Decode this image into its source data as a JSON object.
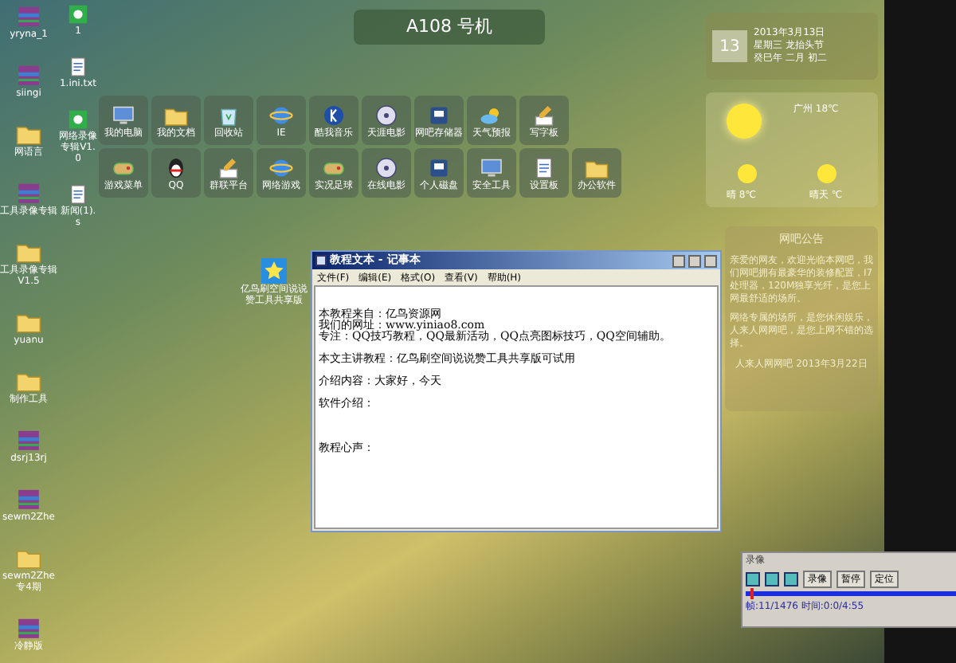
{
  "desktop_icons": [
    {
      "label": "yryna_1",
      "kind": "archive"
    },
    {
      "label": "siingi",
      "kind": "archive"
    },
    {
      "label": "网语言",
      "kind": "folder"
    },
    {
      "label": "工具录像专辑",
      "kind": "archive"
    },
    {
      "label": "工具录像专辑V1.5",
      "kind": "folder"
    },
    {
      "label": "yuanu",
      "kind": "folder"
    },
    {
      "label": "制作工具",
      "kind": "folder"
    },
    {
      "label": "dsrj13rj",
      "kind": "archive"
    },
    {
      "label": "sewm2Zhe",
      "kind": "archive"
    },
    {
      "label": "sewm2Zhe专4期",
      "kind": "folder"
    },
    {
      "label": "冷静版",
      "kind": "archive"
    }
  ],
  "desktop_icons_second_column": [
    {
      "label": "1",
      "kind": "app"
    },
    {
      "label": "1.ini.txt",
      "kind": "file"
    },
    {
      "label": "网络录像专辑V1.0",
      "kind": "app"
    },
    {
      "label": "新闻(1).s",
      "kind": "file"
    }
  ],
  "star_icon": {
    "label": "亿鸟刷空间说说赞工具共享版"
  },
  "machine": {
    "title": "A108 号机"
  },
  "launcher": [
    [
      {
        "label": "我的电脑",
        "kind": "computer"
      },
      {
        "label": "我的文档",
        "kind": "folder"
      },
      {
        "label": "回收站",
        "kind": "bin"
      },
      {
        "label": "IE",
        "kind": "ie"
      },
      {
        "label": "酷我音乐",
        "kind": "music"
      },
      {
        "label": "天涯电影",
        "kind": "film"
      },
      {
        "label": "网吧存储器",
        "kind": "disk"
      },
      {
        "label": "天气预报",
        "kind": "weather"
      },
      {
        "label": "写字板",
        "kind": "pencil"
      }
    ],
    [
      {
        "label": "游戏菜单",
        "kind": "game"
      },
      {
        "label": "QQ",
        "kind": "qq"
      },
      {
        "label": "群联平台",
        "kind": "pencil"
      },
      {
        "label": "网络游戏",
        "kind": "ie"
      },
      {
        "label": "实况足球",
        "kind": "game"
      },
      {
        "label": "在线电影",
        "kind": "film"
      },
      {
        "label": "个人磁盘",
        "kind": "disk"
      },
      {
        "label": "安全工具",
        "kind": "computer"
      },
      {
        "label": "设置板",
        "kind": "file"
      },
      {
        "label": "办公软件",
        "kind": "folder"
      }
    ]
  ],
  "calendar": {
    "day": "13",
    "lines": [
      "2013年3月13日",
      "星期三 龙抬头节",
      "癸巳年 二月 初二"
    ]
  },
  "weather": {
    "city": "广州 18℃",
    "today": "晴 8℃",
    "tomorrow": "晴天 ℃"
  },
  "notice": {
    "title": "网吧公告",
    "paragraphs": [
      "亲爱的网友，欢迎光临本网吧，我们网吧拥有最豪华的装修配置，I7处理器，120M独享光纤，是您上网最舒适的场所。",
      "网络专属的场所，是您休闲娱乐，人来人网网吧，是您上网不错的选择。"
    ],
    "signature": "人来人网网吧 2013年3月22日"
  },
  "notepad": {
    "title": "教程文本 - 记事本",
    "menu": [
      "文件(F)",
      "编辑(E)",
      "格式(O)",
      "查看(V)",
      "帮助(H)"
    ],
    "paragraphs": [
      [
        "本教程来自：亿鸟资源网",
        "我们的网址：www.yiniao8.com",
        "专注：QQ技巧教程，QQ最新活动，QQ点亮图标技巧，QQ空间辅助。"
      ],
      [
        "本文主讲教程：亿鸟刷空间说说赞工具共享版可试用"
      ],
      [
        "介绍内容：大家好，今天"
      ],
      [
        "软件介绍："
      ],
      [
        "教程心声："
      ]
    ]
  },
  "recorder": {
    "title": "录像",
    "buttons": [
      "录像",
      "暂停",
      "定位"
    ],
    "status": "帧:11/1476 时间:0:0/4:55",
    "level": 0.02
  }
}
